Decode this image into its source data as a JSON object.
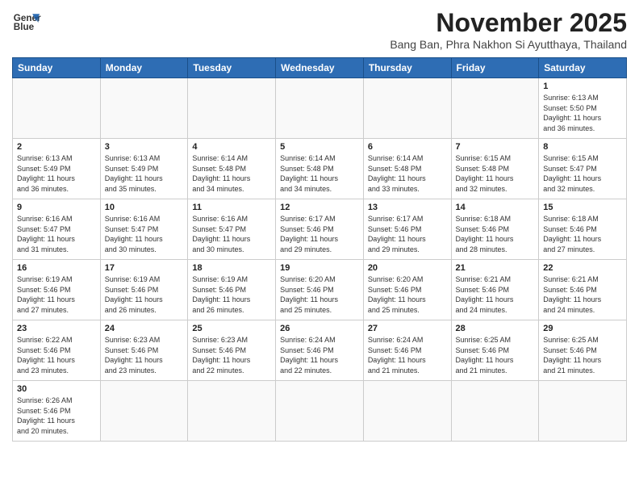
{
  "header": {
    "logo_line1": "General",
    "logo_line2": "Blue",
    "month_title": "November 2025",
    "subtitle": "Bang Ban, Phra Nakhon Si Ayutthaya, Thailand"
  },
  "days_of_week": [
    "Sunday",
    "Monday",
    "Tuesday",
    "Wednesday",
    "Thursday",
    "Friday",
    "Saturday"
  ],
  "weeks": [
    [
      {
        "day": "",
        "info": ""
      },
      {
        "day": "",
        "info": ""
      },
      {
        "day": "",
        "info": ""
      },
      {
        "day": "",
        "info": ""
      },
      {
        "day": "",
        "info": ""
      },
      {
        "day": "",
        "info": ""
      },
      {
        "day": "1",
        "info": "Sunrise: 6:13 AM\nSunset: 5:50 PM\nDaylight: 11 hours\nand 36 minutes."
      }
    ],
    [
      {
        "day": "2",
        "info": "Sunrise: 6:13 AM\nSunset: 5:49 PM\nDaylight: 11 hours\nand 36 minutes."
      },
      {
        "day": "3",
        "info": "Sunrise: 6:13 AM\nSunset: 5:49 PM\nDaylight: 11 hours\nand 35 minutes."
      },
      {
        "day": "4",
        "info": "Sunrise: 6:14 AM\nSunset: 5:48 PM\nDaylight: 11 hours\nand 34 minutes."
      },
      {
        "day": "5",
        "info": "Sunrise: 6:14 AM\nSunset: 5:48 PM\nDaylight: 11 hours\nand 34 minutes."
      },
      {
        "day": "6",
        "info": "Sunrise: 6:14 AM\nSunset: 5:48 PM\nDaylight: 11 hours\nand 33 minutes."
      },
      {
        "day": "7",
        "info": "Sunrise: 6:15 AM\nSunset: 5:48 PM\nDaylight: 11 hours\nand 32 minutes."
      },
      {
        "day": "8",
        "info": "Sunrise: 6:15 AM\nSunset: 5:47 PM\nDaylight: 11 hours\nand 32 minutes."
      }
    ],
    [
      {
        "day": "9",
        "info": "Sunrise: 6:16 AM\nSunset: 5:47 PM\nDaylight: 11 hours\nand 31 minutes."
      },
      {
        "day": "10",
        "info": "Sunrise: 6:16 AM\nSunset: 5:47 PM\nDaylight: 11 hours\nand 30 minutes."
      },
      {
        "day": "11",
        "info": "Sunrise: 6:16 AM\nSunset: 5:47 PM\nDaylight: 11 hours\nand 30 minutes."
      },
      {
        "day": "12",
        "info": "Sunrise: 6:17 AM\nSunset: 5:46 PM\nDaylight: 11 hours\nand 29 minutes."
      },
      {
        "day": "13",
        "info": "Sunrise: 6:17 AM\nSunset: 5:46 PM\nDaylight: 11 hours\nand 29 minutes."
      },
      {
        "day": "14",
        "info": "Sunrise: 6:18 AM\nSunset: 5:46 PM\nDaylight: 11 hours\nand 28 minutes."
      },
      {
        "day": "15",
        "info": "Sunrise: 6:18 AM\nSunset: 5:46 PM\nDaylight: 11 hours\nand 27 minutes."
      }
    ],
    [
      {
        "day": "16",
        "info": "Sunrise: 6:19 AM\nSunset: 5:46 PM\nDaylight: 11 hours\nand 27 minutes."
      },
      {
        "day": "17",
        "info": "Sunrise: 6:19 AM\nSunset: 5:46 PM\nDaylight: 11 hours\nand 26 minutes."
      },
      {
        "day": "18",
        "info": "Sunrise: 6:19 AM\nSunset: 5:46 PM\nDaylight: 11 hours\nand 26 minutes."
      },
      {
        "day": "19",
        "info": "Sunrise: 6:20 AM\nSunset: 5:46 PM\nDaylight: 11 hours\nand 25 minutes."
      },
      {
        "day": "20",
        "info": "Sunrise: 6:20 AM\nSunset: 5:46 PM\nDaylight: 11 hours\nand 25 minutes."
      },
      {
        "day": "21",
        "info": "Sunrise: 6:21 AM\nSunset: 5:46 PM\nDaylight: 11 hours\nand 24 minutes."
      },
      {
        "day": "22",
        "info": "Sunrise: 6:21 AM\nSunset: 5:46 PM\nDaylight: 11 hours\nand 24 minutes."
      }
    ],
    [
      {
        "day": "23",
        "info": "Sunrise: 6:22 AM\nSunset: 5:46 PM\nDaylight: 11 hours\nand 23 minutes."
      },
      {
        "day": "24",
        "info": "Sunrise: 6:23 AM\nSunset: 5:46 PM\nDaylight: 11 hours\nand 23 minutes."
      },
      {
        "day": "25",
        "info": "Sunrise: 6:23 AM\nSunset: 5:46 PM\nDaylight: 11 hours\nand 22 minutes."
      },
      {
        "day": "26",
        "info": "Sunrise: 6:24 AM\nSunset: 5:46 PM\nDaylight: 11 hours\nand 22 minutes."
      },
      {
        "day": "27",
        "info": "Sunrise: 6:24 AM\nSunset: 5:46 PM\nDaylight: 11 hours\nand 21 minutes."
      },
      {
        "day": "28",
        "info": "Sunrise: 6:25 AM\nSunset: 5:46 PM\nDaylight: 11 hours\nand 21 minutes."
      },
      {
        "day": "29",
        "info": "Sunrise: 6:25 AM\nSunset: 5:46 PM\nDaylight: 11 hours\nand 21 minutes."
      }
    ],
    [
      {
        "day": "30",
        "info": "Sunrise: 6:26 AM\nSunset: 5:46 PM\nDaylight: 11 hours\nand 20 minutes."
      },
      {
        "day": "",
        "info": ""
      },
      {
        "day": "",
        "info": ""
      },
      {
        "day": "",
        "info": ""
      },
      {
        "day": "",
        "info": ""
      },
      {
        "day": "",
        "info": ""
      },
      {
        "day": "",
        "info": ""
      }
    ]
  ]
}
